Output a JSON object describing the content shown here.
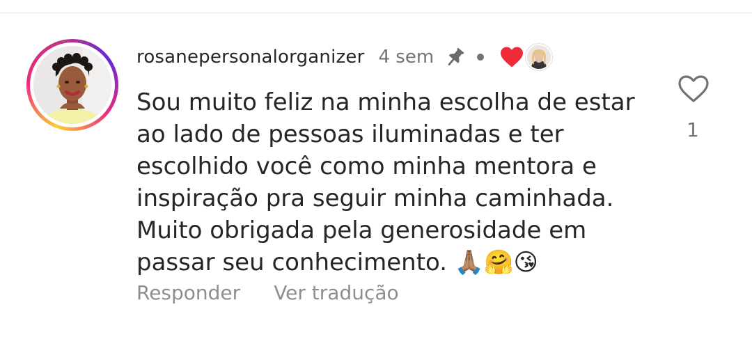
{
  "comment": {
    "author": {
      "username": "rosanepersonalorganizer",
      "avatar": "profile-photo-with-story-ring"
    },
    "timestamp": "4 sem",
    "pinned": true,
    "creator_liked": true,
    "text_lines": [
      "Sou muito feliz na minha escolha de estar",
      "ao lado de pessoas iluminadas e ter",
      "escolhido você como minha mentora e",
      "inspiração pra seguir minha caminhada.",
      "Muito obrigada pela generosidade em",
      "passar seu conhecimento. 🙏🏽🤗😘"
    ],
    "actions": {
      "reply_label": "Responder",
      "translate_label": "Ver tradução"
    },
    "likes": {
      "count": "1",
      "icon": "heart-outline-icon"
    }
  },
  "colors": {
    "text_primary": "#262626",
    "text_secondary": "#737373",
    "action_text": "#8e8e8e",
    "creator_heart": "#ed4956"
  }
}
